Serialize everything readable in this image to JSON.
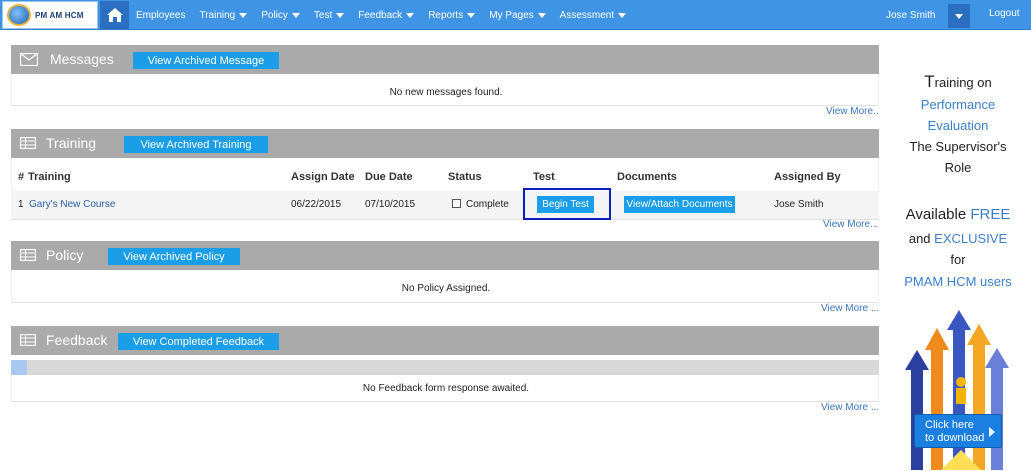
{
  "header": {
    "logo_text": "PM AM HCM",
    "nav": [
      {
        "label": "Employees",
        "has_caret": false
      },
      {
        "label": "Training",
        "has_caret": true
      },
      {
        "label": "Policy",
        "has_caret": true
      },
      {
        "label": "Test",
        "has_caret": true
      },
      {
        "label": "Feedback",
        "has_caret": true
      },
      {
        "label": "Reports",
        "has_caret": true
      },
      {
        "label": "My Pages",
        "has_caret": true
      },
      {
        "label": "Assessment",
        "has_caret": true
      }
    ],
    "user_name": "Jose Smith",
    "logout_label": "Logout",
    "bar_color": "#3f94e6"
  },
  "messages": {
    "title": "Messages",
    "archive_button": "View Archived Message",
    "empty_text": "No new messages found.",
    "view_more": "View More.."
  },
  "training": {
    "title": "Training",
    "archive_button": "View Archived Training",
    "columns": {
      "num": "#",
      "training": "Training",
      "assign_date": "Assign Date",
      "due_date": "Due Date",
      "status": "Status",
      "test": "Test",
      "documents": "Documents",
      "assigned_by": "Assigned By"
    },
    "rows": [
      {
        "num": "1",
        "training": "Gary's New Course",
        "assign_date": "06/22/2015",
        "due_date": "07/10/2015",
        "status": "Complete",
        "test_button": "Begin Test",
        "documents_button": "View/Attach Documents",
        "assigned_by": "Jose Smith"
      }
    ],
    "view_more": "View More..."
  },
  "policy": {
    "title": "Policy",
    "archive_button": "View Archived Policy",
    "empty_text": "No Policy Assigned.",
    "view_more": "View More ..."
  },
  "feedback": {
    "title": "Feedback",
    "completed_button": "View Completed Feedback",
    "progress_fraction": 0.018,
    "empty_text": "No Feedback form response awaited.",
    "view_more": "View More ..."
  },
  "ad": {
    "line1_first_letter": "T",
    "line1_rest": "raining on",
    "line2": "Performance",
    "line3": "Evaluation",
    "line4": "The Supervisor's",
    "line5": "Role",
    "line6_a": "Available ",
    "line6_b": "FREE",
    "line7_a": "and ",
    "line7_b": "EXCLUSIVE",
    "line8": "for",
    "line9": "PMAM HCM users",
    "download_line1": "Click here",
    "download_line2": "to download"
  }
}
